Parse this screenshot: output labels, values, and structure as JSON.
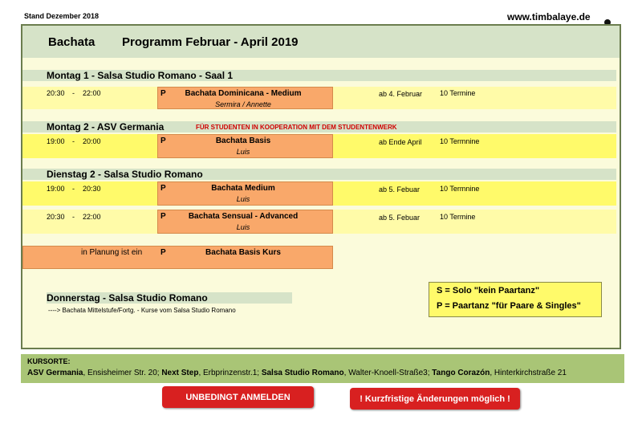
{
  "stand": "Stand Dezember 2018",
  "website": "www.timbalaye.de",
  "header": {
    "dance": "Bachata",
    "title": "Programm Februar - April 2019"
  },
  "sections": [
    {
      "label": "Montag 1 - Salsa Studio Romano - Saal 1"
    },
    {
      "label": "Montag 2 - ASV Germania",
      "note": "FÜR STUDENTEN  IN KOOPERATION MIT DEM STUDENTENWERK"
    },
    {
      "label": "Dienstag 2 - Salsa Studio Romano"
    }
  ],
  "courses": [
    {
      "start": "20:30",
      "dash": "-",
      "end": "22:00",
      "type": "P",
      "name": "Bachata Dominicana - Medium",
      "trainer": "Sermira / Annette",
      "from": "ab 4. Februar",
      "count": "10 Termine"
    },
    {
      "start": "19:00",
      "dash": "-",
      "end": "20:00",
      "type": "P",
      "name": "Bachata Basis",
      "trainer": "Luis",
      "from": "ab Ende April",
      "count": "10 Termnine"
    },
    {
      "start": "19:00",
      "dash": "-",
      "end": "20:30",
      "type": "P",
      "name": "Bachata Medium",
      "trainer": "Luis",
      "from": "ab 5. Febuar",
      "count": "10 Termnine"
    },
    {
      "start": "20:30",
      "dash": "-",
      "end": "22:00",
      "type": "P",
      "name": "Bachata Sensual -  Advanced",
      "trainer": "Luis",
      "from": "ab 5. Febuar",
      "count": "10 Termine"
    }
  ],
  "planning": {
    "label": "in Planung ist ein",
    "type": "P",
    "name": "Bachata Basis Kurs"
  },
  "donnerstag": {
    "label": "Donnerstag - Salsa Studio Romano",
    "note": "----> Bachata  Mittelstufe/Fortg. - Kurse vom  Salsa Studio Romano"
  },
  "legend": {
    "solo": "S = Solo \"kein Paartanz\"",
    "paar": "P = Paartanz  \"für Paare & Singles\""
  },
  "kursorte": {
    "heading": "KURSORTE:",
    "items": [
      {
        "name": "ASV Germania",
        "address": "Ensisheimer Str. 20;"
      },
      {
        "name": "Next Step",
        "address": "Erbprinzenstr.1;"
      },
      {
        "name": "Salsa Studio Romano",
        "address": "Walter-Knoell-Straße3;"
      },
      {
        "name": "Tango Corazón",
        "address": "Hinterkirchstraße 21"
      }
    ]
  },
  "buttons": {
    "register": "UNBEDINGT ANMELDEN",
    "changes": "!  Kurzfristige Änderungen möglich !"
  },
  "colors": {
    "panel": "#fbfbdb",
    "section": "#d6e3c8",
    "row_light": "#fffba8",
    "row_bright": "#fffa6a",
    "course_box": "#f9a86a",
    "kursorte": "#a9c576",
    "button": "#d82020",
    "note": "#d00000"
  },
  "icons": {
    "logo": "conga-dancer-logo"
  }
}
